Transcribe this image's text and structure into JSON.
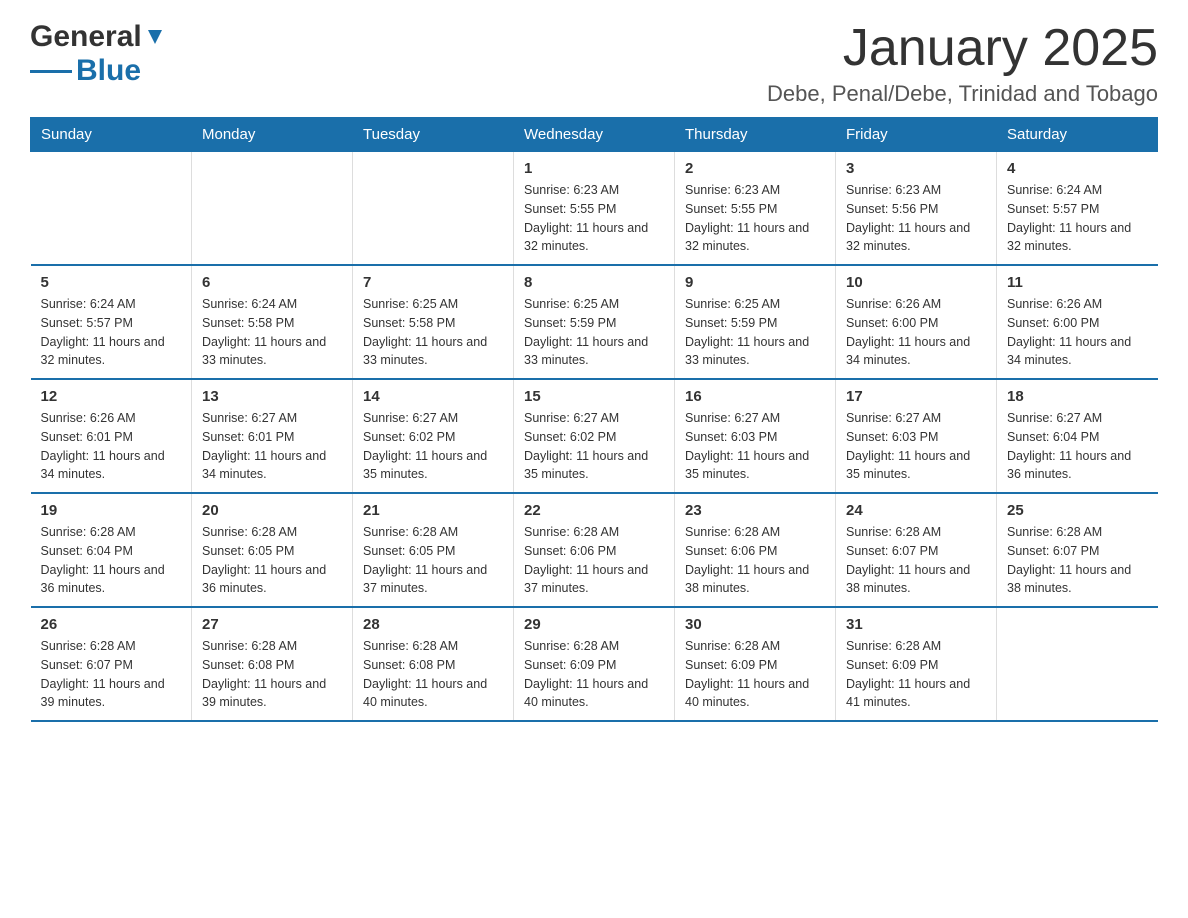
{
  "logo": {
    "text_general": "General",
    "text_blue": "Blue",
    "alt": "GeneralBlue logo"
  },
  "header": {
    "month_year": "January 2025",
    "location": "Debe, Penal/Debe, Trinidad and Tobago"
  },
  "days_of_week": [
    "Sunday",
    "Monday",
    "Tuesday",
    "Wednesday",
    "Thursday",
    "Friday",
    "Saturday"
  ],
  "weeks": [
    {
      "days": [
        {
          "num": "",
          "info": ""
        },
        {
          "num": "",
          "info": ""
        },
        {
          "num": "",
          "info": ""
        },
        {
          "num": "1",
          "info": "Sunrise: 6:23 AM\nSunset: 5:55 PM\nDaylight: 11 hours and 32 minutes."
        },
        {
          "num": "2",
          "info": "Sunrise: 6:23 AM\nSunset: 5:55 PM\nDaylight: 11 hours and 32 minutes."
        },
        {
          "num": "3",
          "info": "Sunrise: 6:23 AM\nSunset: 5:56 PM\nDaylight: 11 hours and 32 minutes."
        },
        {
          "num": "4",
          "info": "Sunrise: 6:24 AM\nSunset: 5:57 PM\nDaylight: 11 hours and 32 minutes."
        }
      ]
    },
    {
      "days": [
        {
          "num": "5",
          "info": "Sunrise: 6:24 AM\nSunset: 5:57 PM\nDaylight: 11 hours and 32 minutes."
        },
        {
          "num": "6",
          "info": "Sunrise: 6:24 AM\nSunset: 5:58 PM\nDaylight: 11 hours and 33 minutes."
        },
        {
          "num": "7",
          "info": "Sunrise: 6:25 AM\nSunset: 5:58 PM\nDaylight: 11 hours and 33 minutes."
        },
        {
          "num": "8",
          "info": "Sunrise: 6:25 AM\nSunset: 5:59 PM\nDaylight: 11 hours and 33 minutes."
        },
        {
          "num": "9",
          "info": "Sunrise: 6:25 AM\nSunset: 5:59 PM\nDaylight: 11 hours and 33 minutes."
        },
        {
          "num": "10",
          "info": "Sunrise: 6:26 AM\nSunset: 6:00 PM\nDaylight: 11 hours and 34 minutes."
        },
        {
          "num": "11",
          "info": "Sunrise: 6:26 AM\nSunset: 6:00 PM\nDaylight: 11 hours and 34 minutes."
        }
      ]
    },
    {
      "days": [
        {
          "num": "12",
          "info": "Sunrise: 6:26 AM\nSunset: 6:01 PM\nDaylight: 11 hours and 34 minutes."
        },
        {
          "num": "13",
          "info": "Sunrise: 6:27 AM\nSunset: 6:01 PM\nDaylight: 11 hours and 34 minutes."
        },
        {
          "num": "14",
          "info": "Sunrise: 6:27 AM\nSunset: 6:02 PM\nDaylight: 11 hours and 35 minutes."
        },
        {
          "num": "15",
          "info": "Sunrise: 6:27 AM\nSunset: 6:02 PM\nDaylight: 11 hours and 35 minutes."
        },
        {
          "num": "16",
          "info": "Sunrise: 6:27 AM\nSunset: 6:03 PM\nDaylight: 11 hours and 35 minutes."
        },
        {
          "num": "17",
          "info": "Sunrise: 6:27 AM\nSunset: 6:03 PM\nDaylight: 11 hours and 35 minutes."
        },
        {
          "num": "18",
          "info": "Sunrise: 6:27 AM\nSunset: 6:04 PM\nDaylight: 11 hours and 36 minutes."
        }
      ]
    },
    {
      "days": [
        {
          "num": "19",
          "info": "Sunrise: 6:28 AM\nSunset: 6:04 PM\nDaylight: 11 hours and 36 minutes."
        },
        {
          "num": "20",
          "info": "Sunrise: 6:28 AM\nSunset: 6:05 PM\nDaylight: 11 hours and 36 minutes."
        },
        {
          "num": "21",
          "info": "Sunrise: 6:28 AM\nSunset: 6:05 PM\nDaylight: 11 hours and 37 minutes."
        },
        {
          "num": "22",
          "info": "Sunrise: 6:28 AM\nSunset: 6:06 PM\nDaylight: 11 hours and 37 minutes."
        },
        {
          "num": "23",
          "info": "Sunrise: 6:28 AM\nSunset: 6:06 PM\nDaylight: 11 hours and 38 minutes."
        },
        {
          "num": "24",
          "info": "Sunrise: 6:28 AM\nSunset: 6:07 PM\nDaylight: 11 hours and 38 minutes."
        },
        {
          "num": "25",
          "info": "Sunrise: 6:28 AM\nSunset: 6:07 PM\nDaylight: 11 hours and 38 minutes."
        }
      ]
    },
    {
      "days": [
        {
          "num": "26",
          "info": "Sunrise: 6:28 AM\nSunset: 6:07 PM\nDaylight: 11 hours and 39 minutes."
        },
        {
          "num": "27",
          "info": "Sunrise: 6:28 AM\nSunset: 6:08 PM\nDaylight: 11 hours and 39 minutes."
        },
        {
          "num": "28",
          "info": "Sunrise: 6:28 AM\nSunset: 6:08 PM\nDaylight: 11 hours and 40 minutes."
        },
        {
          "num": "29",
          "info": "Sunrise: 6:28 AM\nSunset: 6:09 PM\nDaylight: 11 hours and 40 minutes."
        },
        {
          "num": "30",
          "info": "Sunrise: 6:28 AM\nSunset: 6:09 PM\nDaylight: 11 hours and 40 minutes."
        },
        {
          "num": "31",
          "info": "Sunrise: 6:28 AM\nSunset: 6:09 PM\nDaylight: 11 hours and 41 minutes."
        },
        {
          "num": "",
          "info": ""
        }
      ]
    }
  ]
}
